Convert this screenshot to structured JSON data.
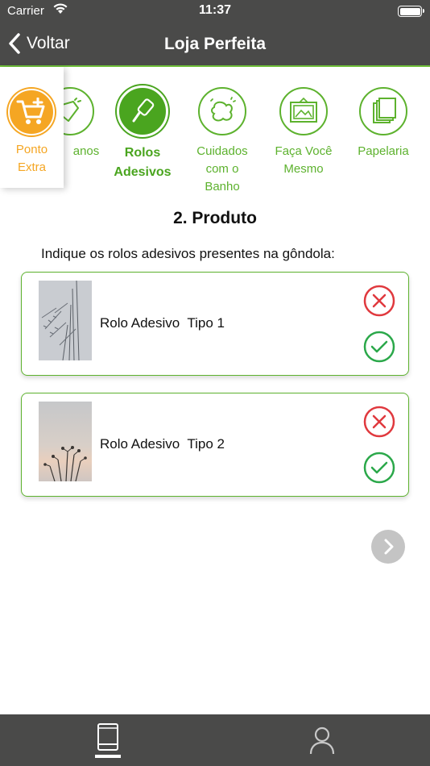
{
  "status_bar": {
    "carrier": "Carrier",
    "time": "11:37"
  },
  "nav": {
    "back_label": "Voltar",
    "title": "Loja Perfeita"
  },
  "ponto_extra": {
    "label_line1": "Ponto",
    "label_line2": "Extra",
    "icon": "cart-plus-icon",
    "color": "#f5a623"
  },
  "categories": [
    {
      "label": "Panos",
      "visible_label": "anos",
      "icon": "cloth-icon",
      "active": false
    },
    {
      "label_line1": "Rolos",
      "label_line2": "Adesivos",
      "icon": "lint-roller-icon",
      "active": true
    },
    {
      "label_line1": "Cuidados",
      "label_line2": "com o",
      "label_line3": "Banho",
      "icon": "sponge-icon",
      "active": false
    },
    {
      "label_line1": "Faça Você",
      "label_line2": "Mesmo",
      "icon": "picture-frame-icon",
      "active": false
    },
    {
      "label": "Papelaria",
      "icon": "paper-stack-icon",
      "active": false
    }
  ],
  "section": {
    "title": "2. Produto",
    "instruction": "Indique os rolos adesivos presentes na gôndola:"
  },
  "products": [
    {
      "name": "Rolo Adesivo  Tipo 1",
      "image": "grass-photo"
    },
    {
      "name": "Rolo Adesivo  Tipo 2",
      "image": "sunset-plants-photo"
    }
  ],
  "colors": {
    "accent_green": "#5db22e",
    "reject_red": "#e0393e",
    "accept_green": "#2ba84a",
    "header_bg": "#4a4a49"
  },
  "tabs": [
    {
      "icon": "tablet-icon",
      "selected": true
    },
    {
      "icon": "user-icon",
      "selected": false
    }
  ]
}
